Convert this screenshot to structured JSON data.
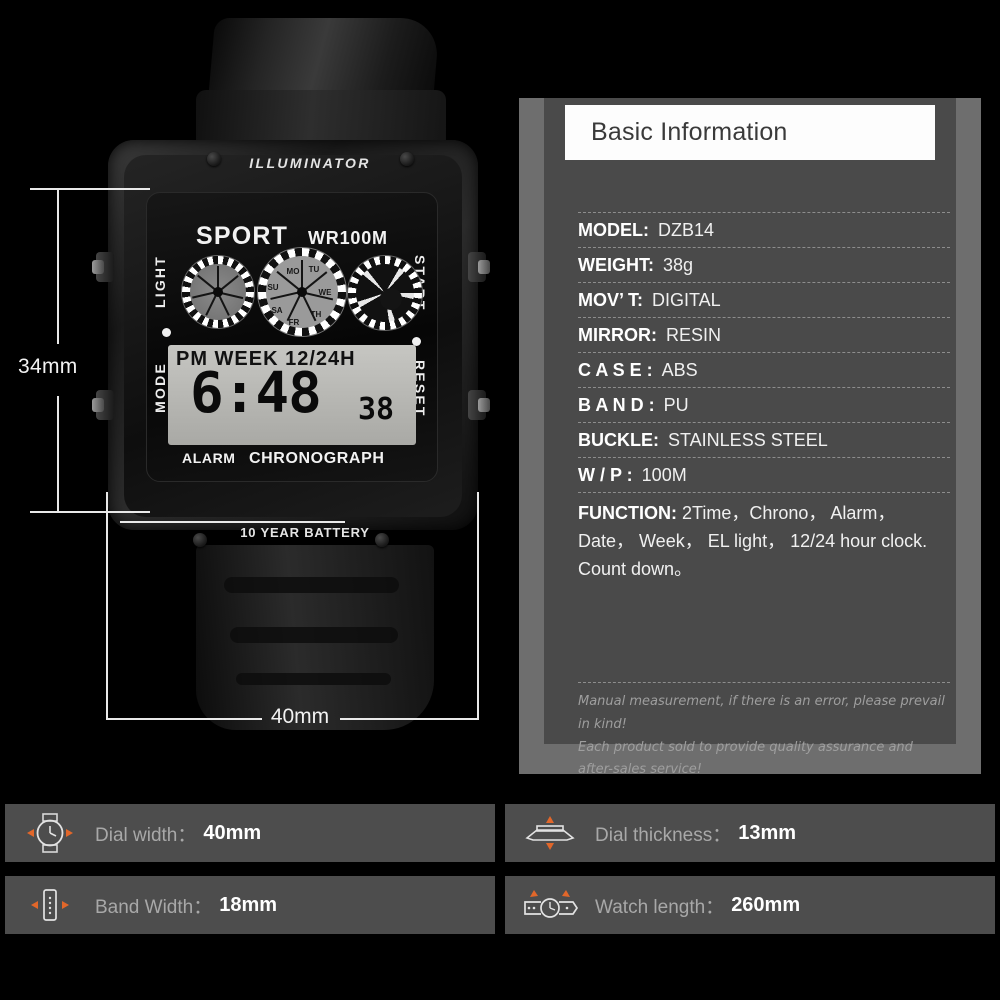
{
  "product_photo": {
    "dimensions": {
      "height_label": "34mm",
      "width_label": "40mm"
    },
    "watch": {
      "bezel_top_text": "ILLUMINATOR",
      "bezel_bottom_text": "10 YEAR BATTERY",
      "dial_brand": "SPORT",
      "dial_water_resist": "WR100M",
      "dial_alarm": "ALARM",
      "dial_chronograph": "CHRONOGRAPH",
      "button_light": "LIGHT",
      "button_mode": "MODE",
      "button_start": "START",
      "button_reset": "RESET",
      "lcd_top": "PM WEEK 12/24H",
      "lcd_time": "6:48",
      "lcd_seconds": "38",
      "weekdays": [
        "MO",
        "TU",
        "WE",
        "TH",
        "FR",
        "SA",
        "SU"
      ]
    }
  },
  "info_panel": {
    "title": "Basic Information",
    "specs": [
      {
        "key": "MODEL:",
        "value": "DZB14"
      },
      {
        "key": "WEIGHT:",
        "value": "38g"
      },
      {
        "key": "MOV’ T:",
        "value": "DIGITAL"
      },
      {
        "key": "MIRROR:",
        "value": "RESIN"
      },
      {
        "key": "C A S E :",
        "value": "ABS"
      },
      {
        "key": "B A N D :",
        "value": "PU"
      },
      {
        "key": "BUCKLE:",
        "value": "STAINLESS STEEL"
      },
      {
        "key": "W / P :",
        "value": "100M"
      }
    ],
    "function": {
      "key": "FUNCTION:",
      "line1": "2Time，Chrono， Alarm，",
      "line2": "Date， Week， EL light， 12/24 hour clock.",
      "line3": "Count down。"
    },
    "disclaimer": {
      "line1": "Manual measurement, if there is an error, please prevail in kind!",
      "line2": "Each product sold to provide quality assurance and after-sales service!"
    }
  },
  "spec_cards": [
    {
      "icon": "watch-face-icon",
      "label": "Dial width：",
      "value": "40mm"
    },
    {
      "icon": "watch-thickness-icon",
      "label": "Dial thickness：",
      "value": "13mm"
    },
    {
      "icon": "watch-band-icon",
      "label": "Band Width：",
      "value": "18mm"
    },
    {
      "icon": "watch-length-icon",
      "label": "Watch length：",
      "value": "260mm"
    }
  ],
  "colors": {
    "background": "#000000",
    "panel_frame": "#6e6e6e",
    "panel_inner": "#4a4a4a",
    "card_bg": "#4d4d4d",
    "accent_orange": "#e2672a",
    "title_bar": "#fdfdfd"
  }
}
